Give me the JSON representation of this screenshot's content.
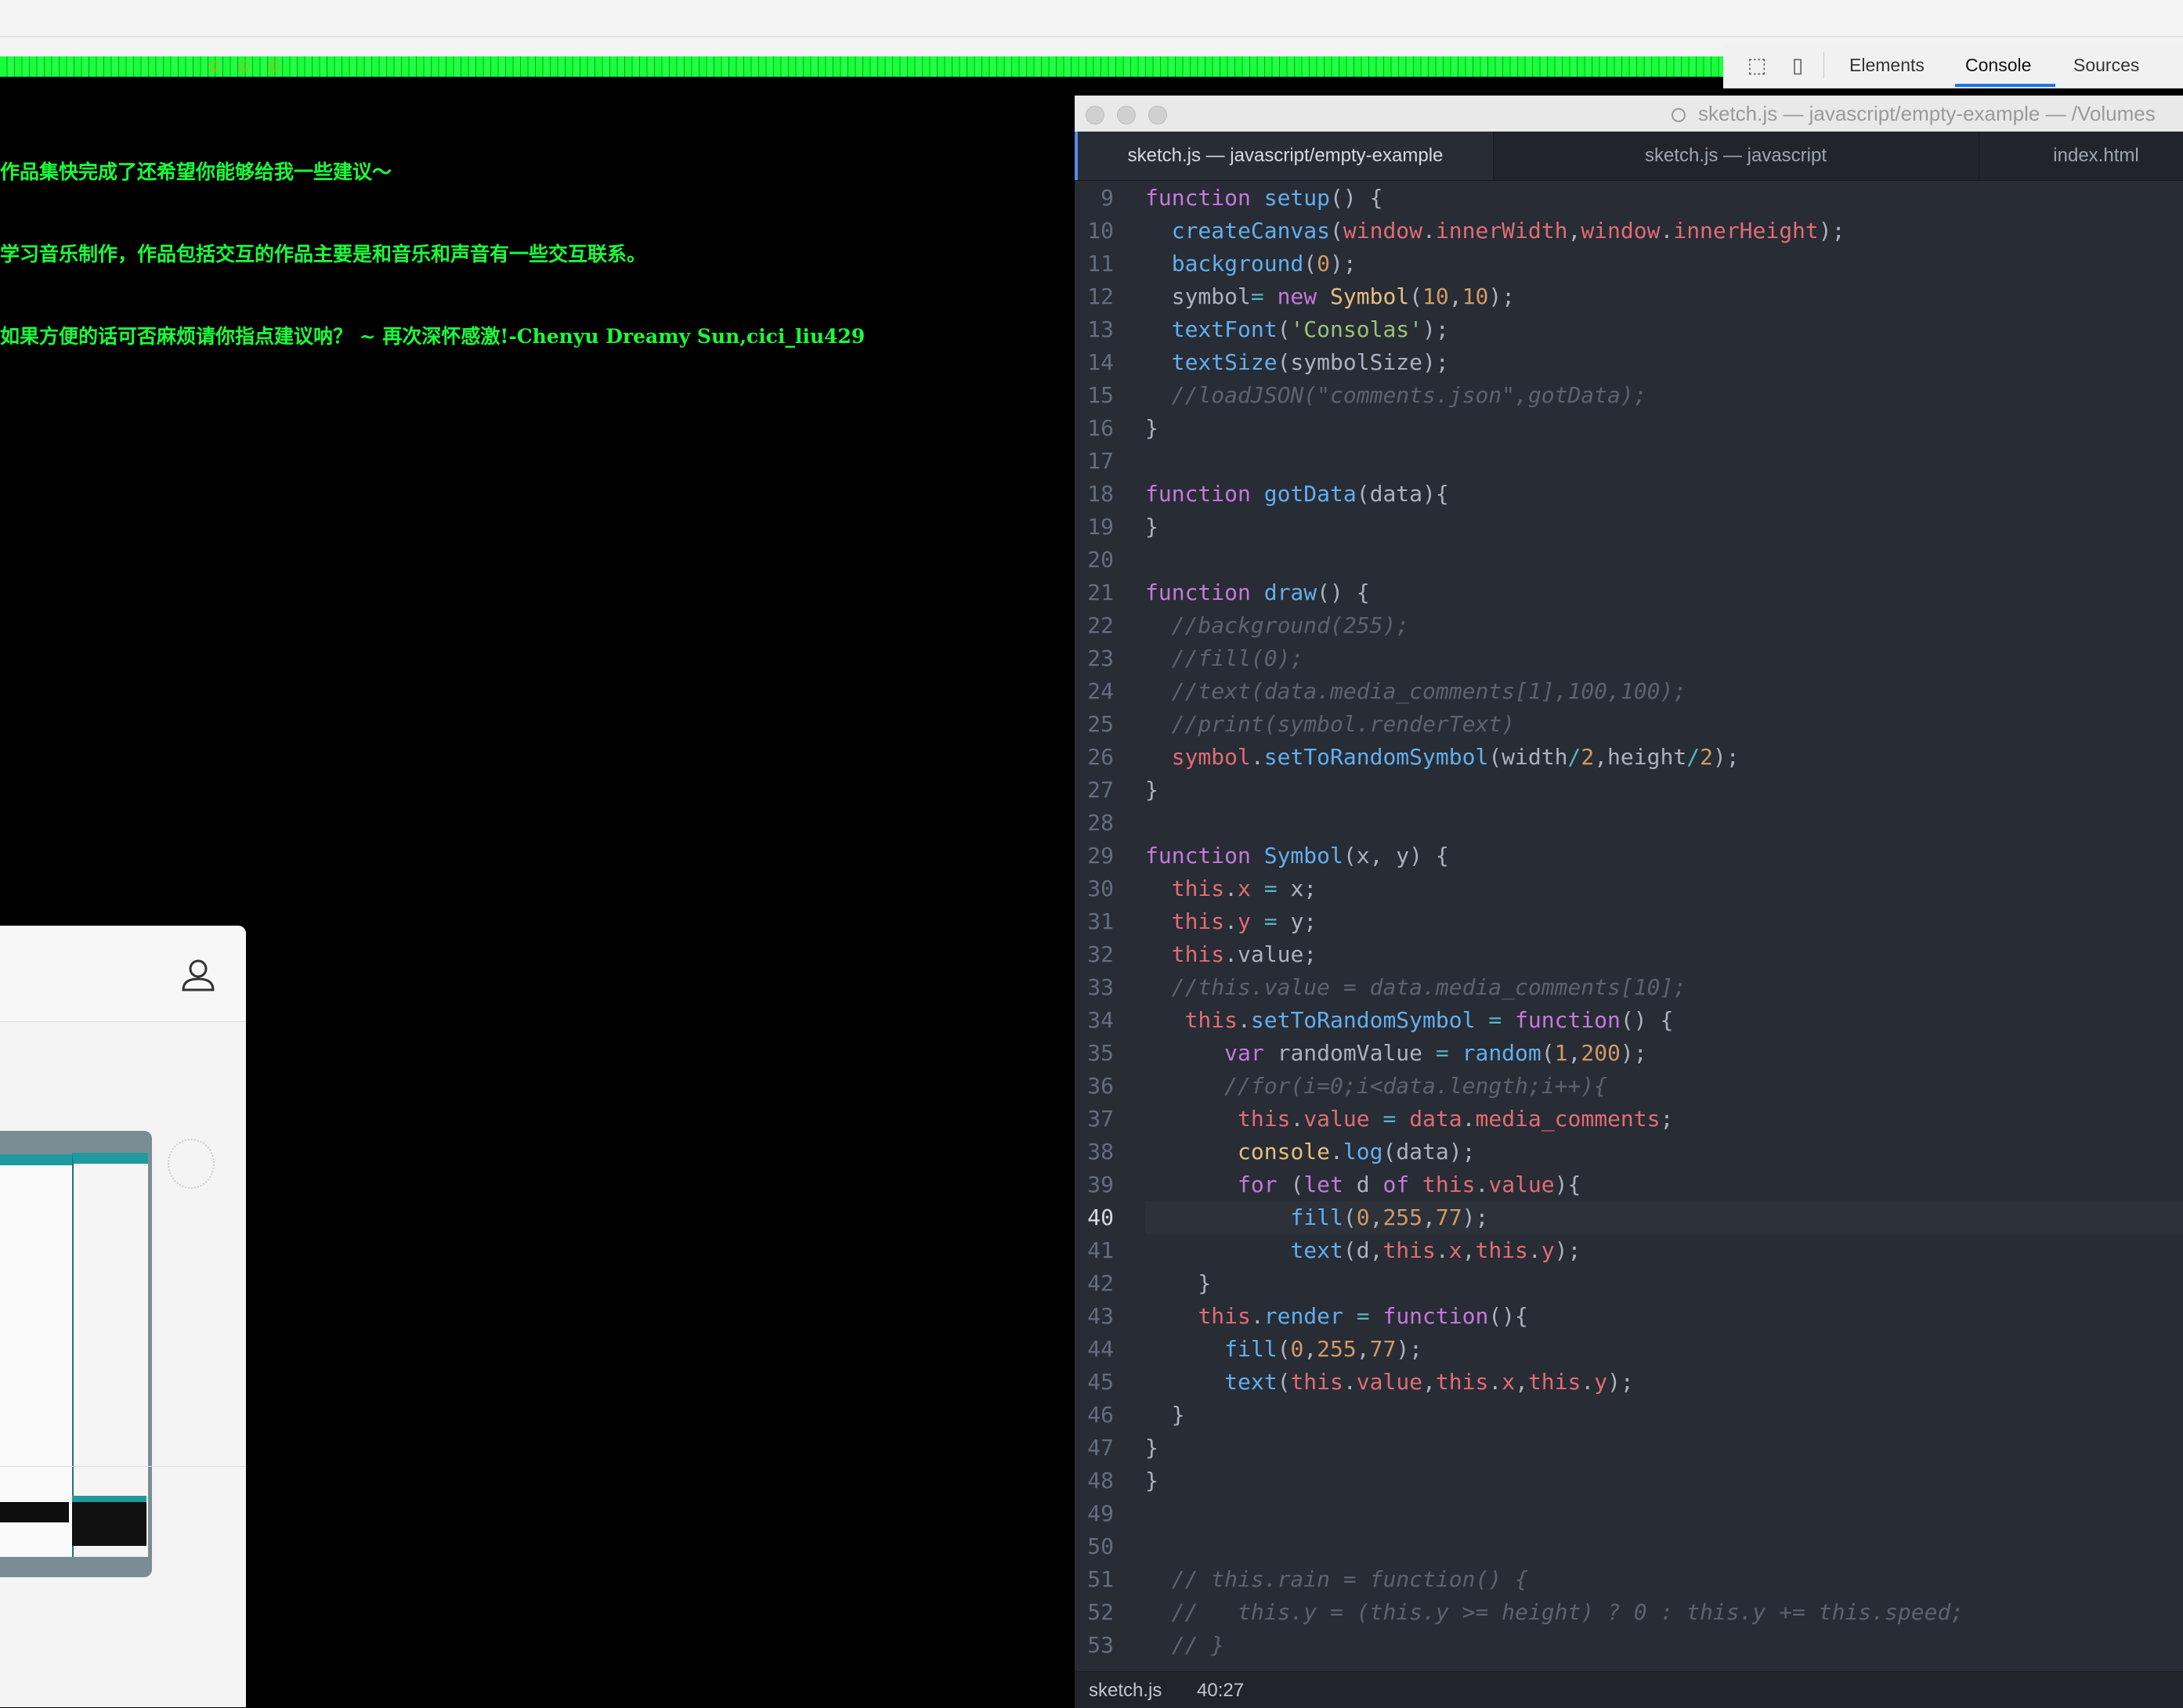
{
  "devtools": {
    "tabs": [
      "Elements",
      "Console",
      "Sources"
    ],
    "active_tab": "Console"
  },
  "comments": [
    "作品集快完成了还希望你能够给我一些建议～",
    "学习音乐制作，作品包括交互的作品主要是和音乐和声音有一些交互联系。",
    "如果方便的话可否麻烦请你指点建议呐？ ~ 再次深怀感激!-Chenyu Dreamy Sun,cici_liu429"
  ],
  "editor": {
    "window_title": "sketch.js — javascript/empty-example — /Volumes",
    "tabs": [
      {
        "label": "sketch.js — javascript/empty-example",
        "active": true
      },
      {
        "label": "sketch.js — javascript",
        "active": false
      },
      {
        "label": "index.html",
        "active": false
      }
    ],
    "current_line": 40,
    "status": {
      "file": "sketch.js",
      "cursor": "40:27"
    },
    "lines": [
      {
        "n": "9",
        "html": "<span class='k'>function</span> <span class='f'>setup</span>() {"
      },
      {
        "n": "10",
        "html": "  <span class='f'>createCanvas</span>(<span class='p'>window</span>.<span class='p'>innerWidth</span>,<span class='p'>window</span>.<span class='p'>innerHeight</span>);"
      },
      {
        "n": "11",
        "html": "  <span class='f'>background</span>(<span class='n'>0</span>);"
      },
      {
        "n": "12",
        "html": "  symbol<span class='o'>=</span> <span class='k'>new</span> <span class='y'>Symbol</span>(<span class='n'>10</span>,<span class='n'>10</span>);"
      },
      {
        "n": "13",
        "html": "  <span class='f'>textFont</span>(<span class='s'>'Consolas'</span>);"
      },
      {
        "n": "14",
        "html": "  <span class='f'>textSize</span>(symbolSize);"
      },
      {
        "n": "15",
        "html": "  <span class='c'>//loadJSON(\"comments.json\",gotData);</span>"
      },
      {
        "n": "16",
        "html": "}"
      },
      {
        "n": "17",
        "html": ""
      },
      {
        "n": "18",
        "html": "<span class='k'>function</span> <span class='f'>gotData</span>(data){"
      },
      {
        "n": "19",
        "html": "}"
      },
      {
        "n": "20",
        "html": ""
      },
      {
        "n": "21",
        "html": "<span class='k'>function</span> <span class='f'>draw</span>() {"
      },
      {
        "n": "22",
        "html": "  <span class='c'>//background(255);</span>"
      },
      {
        "n": "23",
        "html": "  <span class='c'>//fill(0);</span>"
      },
      {
        "n": "24",
        "html": "  <span class='c'>//text(data.media_comments[1],100,100);</span>"
      },
      {
        "n": "25",
        "html": "  <span class='c'>//print(symbol.renderText)</span>"
      },
      {
        "n": "26",
        "html": "  <span class='p'>symbol</span>.<span class='f'>setToRandomSymbol</span>(width<span class='o'>/</span><span class='n'>2</span>,height<span class='o'>/</span><span class='n'>2</span>);"
      },
      {
        "n": "27",
        "html": "}"
      },
      {
        "n": "28",
        "html": ""
      },
      {
        "n": "29",
        "html": "<span class='k'>function</span> <span class='f'>Symbol</span>(x, y) {"
      },
      {
        "n": "30",
        "html": "  <span class='p'>this</span>.<span class='p'>x</span> <span class='o'>=</span> x;"
      },
      {
        "n": "31",
        "html": "  <span class='p'>this</span>.<span class='p'>y</span> <span class='o'>=</span> y;"
      },
      {
        "n": "32",
        "html": "  <span class='p'>this</span>.value;"
      },
      {
        "n": "33",
        "html": "  <span class='c'>//this.value = data.media_comments[10];</span>"
      },
      {
        "n": "34",
        "html": "   <span class='p'>this</span>.<span class='f'>setToRandomSymbol</span> <span class='o'>=</span> <span class='k'>function</span>() {"
      },
      {
        "n": "35",
        "html": "      <span class='k'>var</span> randomValue <span class='o'>=</span> <span class='f'>random</span>(<span class='n'>1</span>,<span class='n'>200</span>);"
      },
      {
        "n": "36",
        "html": "      <span class='c'>//for(i=0;i&lt;data.length;i++){</span>"
      },
      {
        "n": "37",
        "html": "       <span class='p'>this</span>.<span class='p'>value</span> <span class='o'>=</span> <span class='p'>data</span>.<span class='p'>media_comments</span>;"
      },
      {
        "n": "38",
        "html": "       <span class='y'>console</span>.<span class='f'>log</span>(data);"
      },
      {
        "n": "39",
        "html": "       <span class='k'>for</span> (<span class='k'>let</span> d <span class='k'>of</span> <span class='p'>this</span>.<span class='p'>value</span>){"
      },
      {
        "n": "40",
        "html": "           <span class='f'>fill</span>(<span class='n'>0</span>,<span class='n'>255</span>,<span class='n'>77</span>);"
      },
      {
        "n": "41",
        "html": "           <span class='f'>text</span>(d,<span class='p'>this</span>.<span class='p'>x</span>,<span class='p'>this</span>.<span class='p'>y</span>);"
      },
      {
        "n": "42",
        "html": "    }"
      },
      {
        "n": "43",
        "html": "    <span class='p'>this</span>.<span class='f'>render</span> <span class='o'>=</span> <span class='k'>function</span>(){"
      },
      {
        "n": "44",
        "html": "      <span class='f'>fill</span>(<span class='n'>0</span>,<span class='n'>255</span>,<span class='n'>77</span>);"
      },
      {
        "n": "45",
        "html": "      <span class='f'>text</span>(<span class='p'>this</span>.<span class='p'>value</span>,<span class='p'>this</span>.<span class='p'>x</span>,<span class='p'>this</span>.<span class='p'>y</span>);"
      },
      {
        "n": "46",
        "html": "  }"
      },
      {
        "n": "47",
        "html": "}"
      },
      {
        "n": "48",
        "html": "}"
      },
      {
        "n": "49",
        "html": ""
      },
      {
        "n": "50",
        "html": ""
      },
      {
        "n": "51",
        "html": "  <span class='c'>// this.rain = function() {</span>"
      },
      {
        "n": "52",
        "html": "  <span class='c'>//   this.y = (this.y &gt;= height) ? 0 : this.y += this.speed;</span>"
      },
      {
        "n": "53",
        "html": "  <span class='c'>// }</span>"
      }
    ]
  }
}
